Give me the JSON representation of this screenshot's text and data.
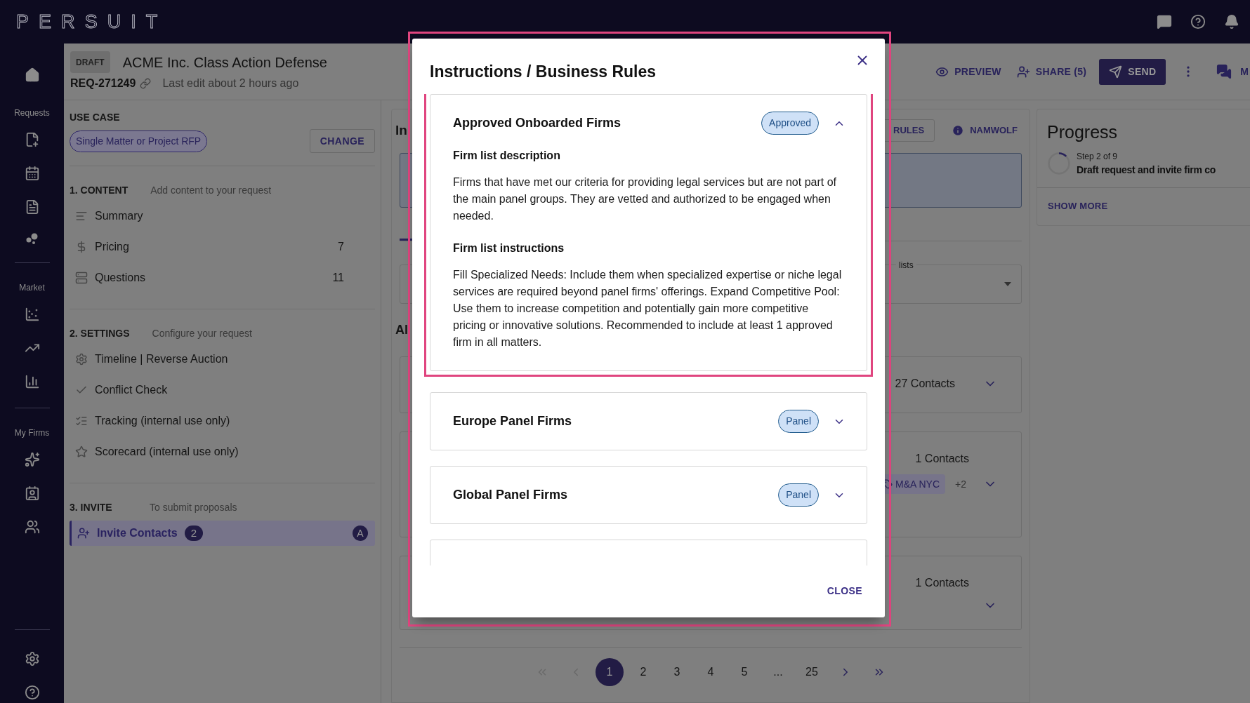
{
  "topbar": {
    "logo": "PERSUIT"
  },
  "nav": {
    "sections": [
      {
        "label": "Requests"
      },
      {
        "label": "Market"
      },
      {
        "label": "My Firms"
      }
    ]
  },
  "request": {
    "status": "DRAFT",
    "title": "ACME Inc. Class Action Defense",
    "id": "REQ-271249",
    "last_edit": "Last edit about 2 hours ago"
  },
  "actions": [
    {
      "label": "PREVIEW",
      "kind": "preview"
    },
    {
      "label": "SHARE (5)",
      "kind": "share"
    },
    {
      "label": "SEND",
      "kind": "send"
    }
  ],
  "messages_label": "M",
  "use_case": {
    "heading": "USE CASE",
    "value": "Single Matter or Project RFP",
    "button": "CHANGE"
  },
  "steps": [
    {
      "title": "1. CONTENT",
      "hint": "Add content to your request",
      "items": [
        {
          "label": "Summary",
          "kind": "summary",
          "selected": false
        },
        {
          "label": "Pricing",
          "kind": "pricing",
          "count": "7",
          "selected": false
        },
        {
          "label": "Questions",
          "kind": "questions",
          "count": "11",
          "selected": false
        }
      ]
    },
    {
      "title": "2. SETTINGS",
      "hint": "Configure your request",
      "items": [
        {
          "label": "Timeline | Reverse Auction",
          "kind": "timeline",
          "selected": false
        },
        {
          "label": "Conflict Check",
          "kind": "conflict",
          "selected": false
        },
        {
          "label": "Tracking (internal use only)",
          "kind": "tracking",
          "selected": false
        },
        {
          "label": "Scorecard (internal use only)",
          "kind": "scorecard",
          "selected": false
        }
      ]
    },
    {
      "title": "3. INVITE",
      "hint": "To submit proposals",
      "items": [
        {
          "label": "Invite Contacts",
          "kind": "invite",
          "badge": "2",
          "avatar": "A",
          "selected": true
        }
      ]
    }
  ],
  "middle": {
    "title": "In",
    "rules_button": "RULES",
    "info_button": "NAMWOLF",
    "field_label": "lists",
    "subtitle": "Al",
    "cards": [
      {
        "contacts": "27 Contacts"
      },
      {
        "contacts": "1 Contacts",
        "chip": "M&A NYC",
        "more": "+2"
      },
      {
        "contacts": "1 Contacts"
      }
    ]
  },
  "pagination": {
    "first_disabled": true,
    "prev_disabled": true,
    "next_disabled": false,
    "last_disabled": false,
    "pages": [
      {
        "label": "1",
        "selected": true
      },
      {
        "label": "2",
        "selected": false
      },
      {
        "label": "3",
        "selected": false
      },
      {
        "label": "4",
        "selected": false
      },
      {
        "label": "5",
        "selected": false
      },
      {
        "label": "...",
        "selected": false
      },
      {
        "label": "25",
        "selected": false
      }
    ]
  },
  "progress": {
    "title": "Progress",
    "step": "Step 2 of 9",
    "stage": "Draft request and invite firm co",
    "link": "SHOW MORE"
  },
  "modal": {
    "title": "Instructions / Business Rules",
    "close_button": "CLOSE",
    "sections": [
      {
        "title": "Approved Onboarded Firms",
        "badge": "Approved",
        "expanded": true,
        "blocks": [
          {
            "heading": "Firm list description",
            "text": "Firms that have met our criteria for providing legal services but are not part of the main panel groups. They are vetted and authorized to be engaged when needed."
          },
          {
            "heading": "Firm list instructions",
            "text": "Fill Specialized Needs: Include them when specialized expertise or niche legal services are required beyond panel firms' offerings. Expand Competitive Pool: Use them to increase competition and potentially gain more competitive pricing or innovative solutions. Recommended to include at least 1 approved firm in all matters."
          }
        ]
      },
      {
        "title": "Europe Panel Firms",
        "badge": "Panel",
        "expanded": false
      },
      {
        "title": "Global Panel Firms",
        "badge": "Panel",
        "expanded": false
      }
    ]
  }
}
